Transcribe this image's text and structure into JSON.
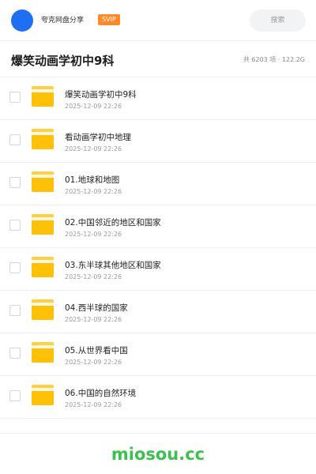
{
  "topbar": {
    "share_title": "夸克网盘分享",
    "badge": "SVIP",
    "search_placeholder": "搜索",
    "avatar_color": "#1e6ff2"
  },
  "header": {
    "title": "爆笑动画学初中9科",
    "meta": "共 6203 项 · 122.2G"
  },
  "items": [
    {
      "name": "爆笑动画学初中9科",
      "date": "2025-12-09 22:26",
      "icon": "folder-icon"
    },
    {
      "name": "看动画学初中地理",
      "date": "2025-12-09 22:26",
      "icon": "folder-icon"
    },
    {
      "name": "01.地球和地图",
      "date": "2025-12-09 22:26",
      "icon": "folder-icon"
    },
    {
      "name": "02.中国邻近的地区和国家",
      "date": "2025-12-09 22:26",
      "icon": "folder-icon"
    },
    {
      "name": "03.东半球其他地区和国家",
      "date": "2025-12-09 22:26",
      "icon": "folder-icon"
    },
    {
      "name": "04.西半球的国家",
      "date": "2025-12-09 22:26",
      "icon": "folder-icon"
    },
    {
      "name": "05.从世界看中国",
      "date": "2025-12-09 22:26",
      "icon": "folder-icon"
    },
    {
      "name": "06.中国的自然环境",
      "date": "2025-12-09 22:26",
      "icon": "folder-icon"
    }
  ],
  "footer": {
    "brand": "miosou.cc",
    "brand_color": "#3cc04e"
  },
  "colors": {
    "folder": "#ffc107",
    "badge": "#ff8a2a"
  }
}
